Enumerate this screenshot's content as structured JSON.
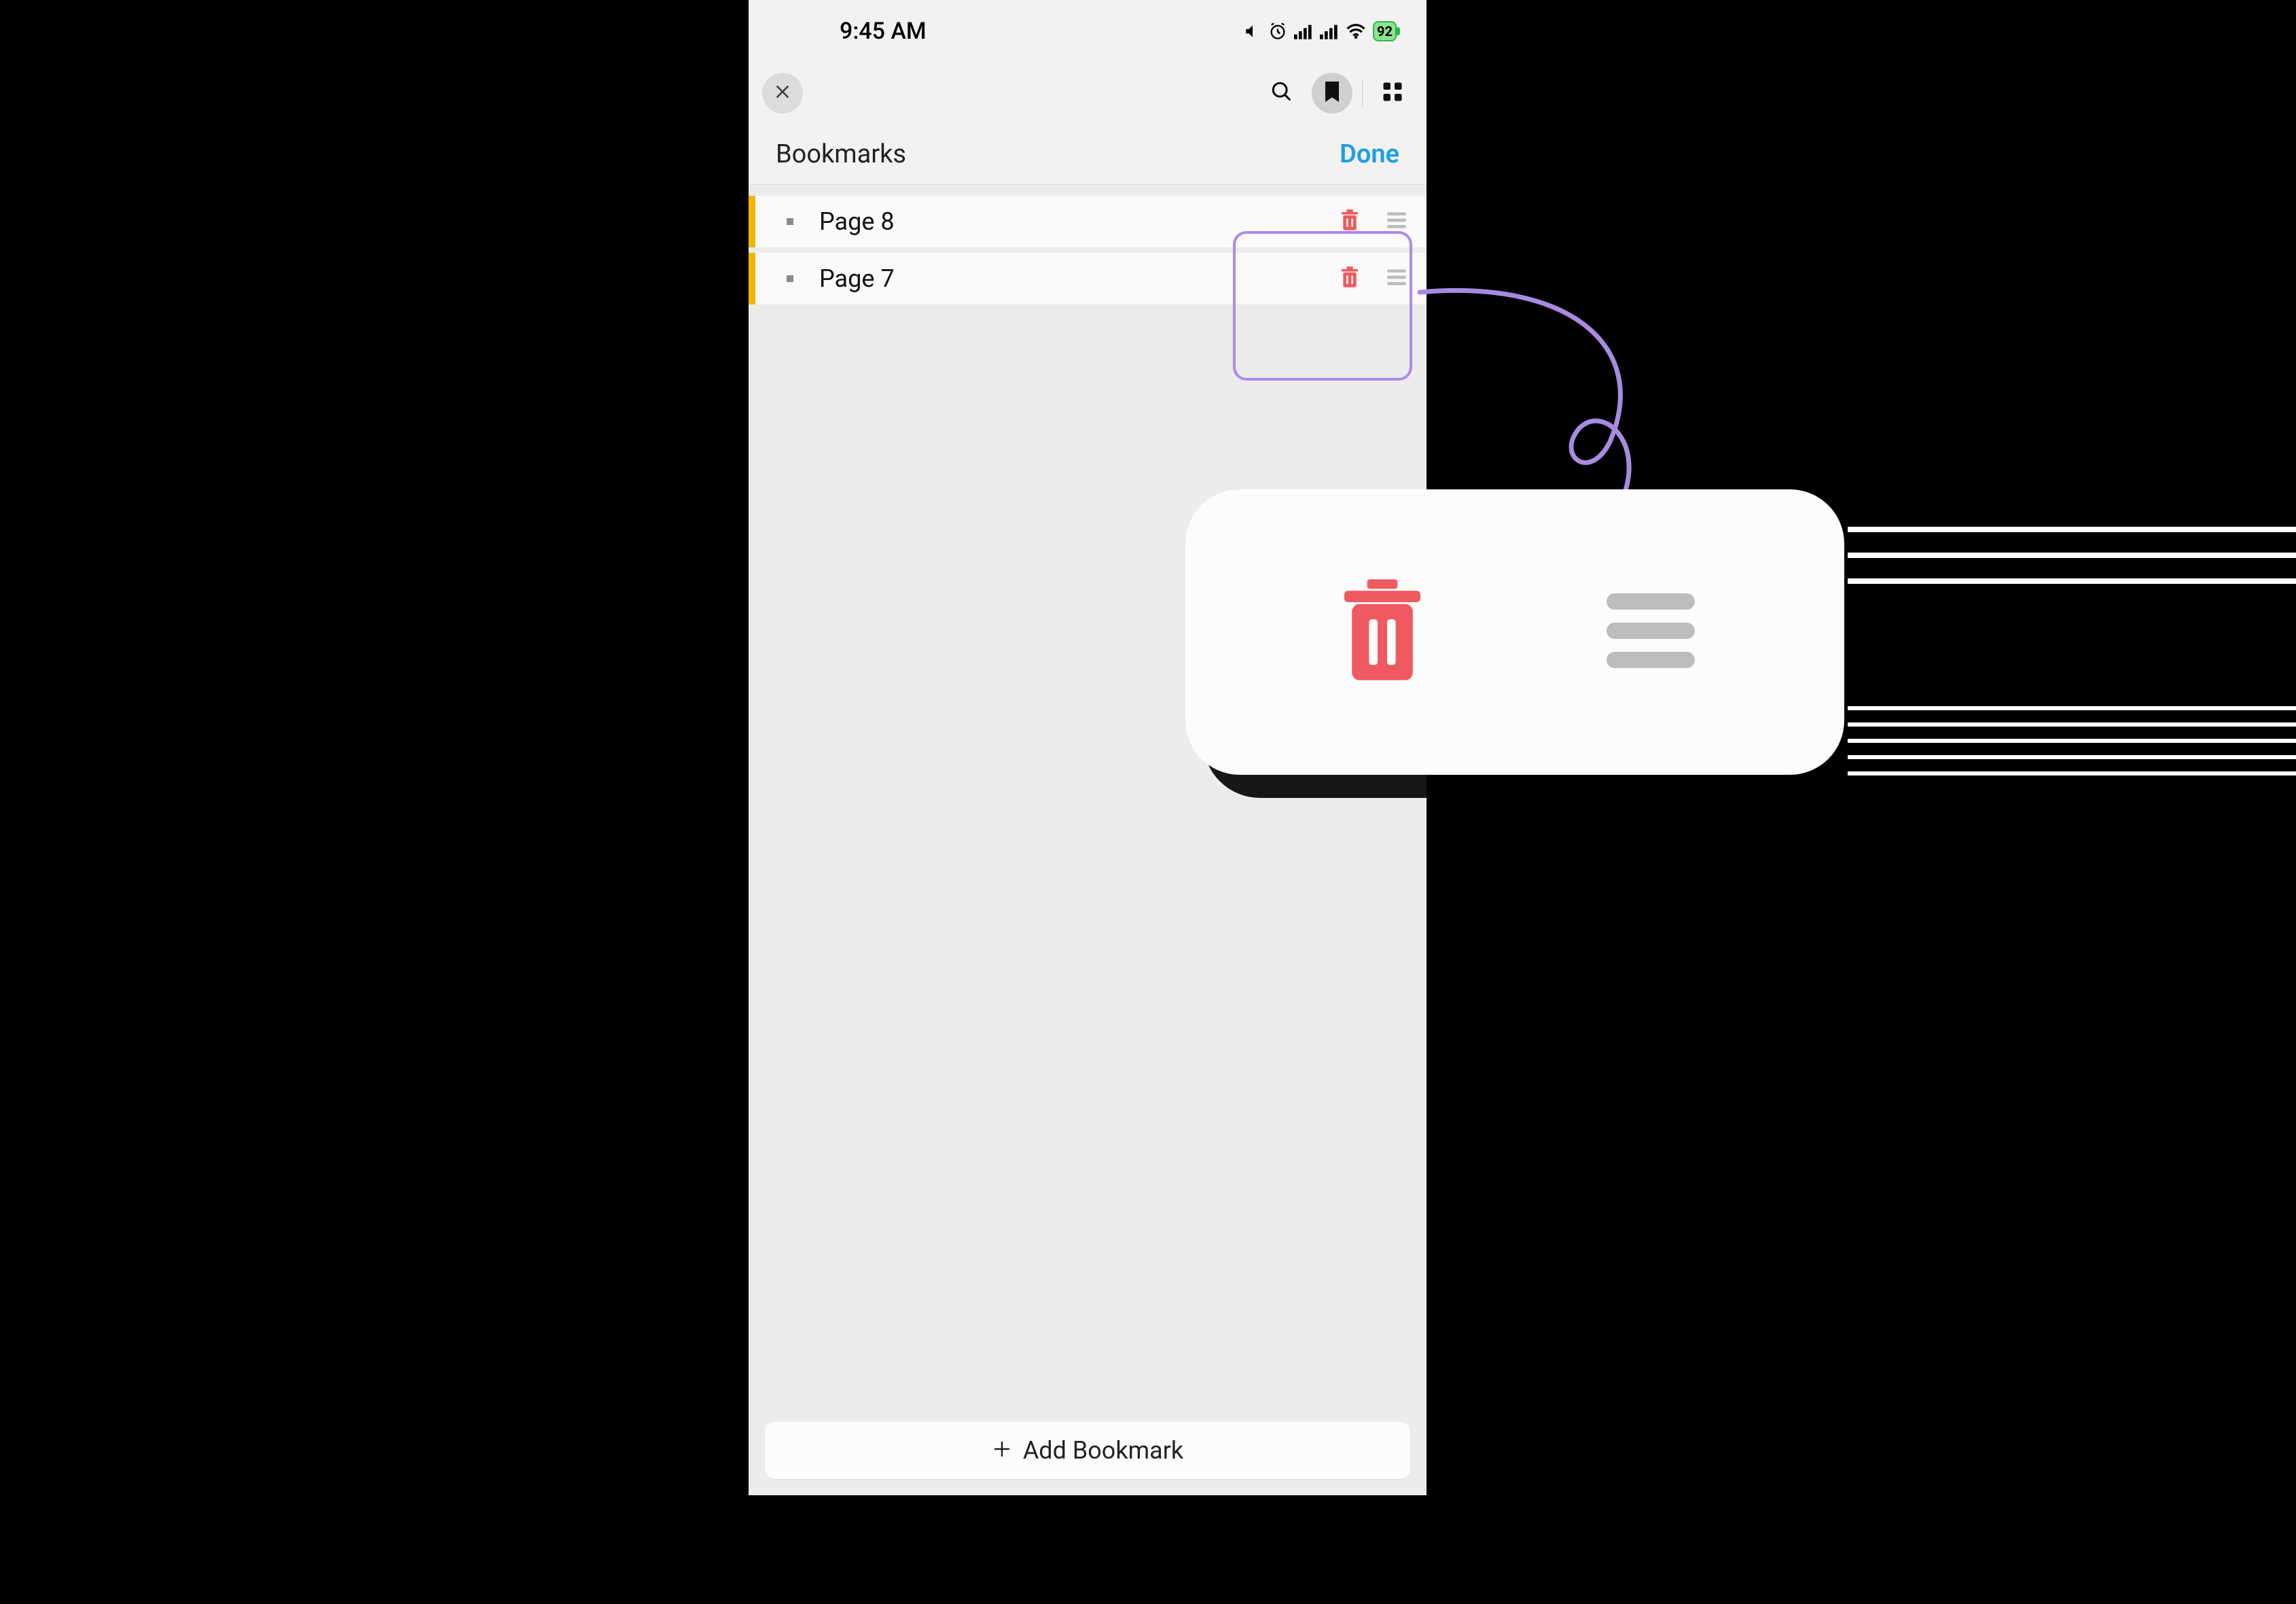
{
  "status": {
    "time": "9:45 AM",
    "battery": "92"
  },
  "section": {
    "title": "Bookmarks",
    "done_label": "Done"
  },
  "bookmarks": [
    {
      "label": "Page 8"
    },
    {
      "label": "Page 7"
    }
  ],
  "footer": {
    "add_label": "Add Bookmark"
  },
  "colors": {
    "accent": "#1e9ee6",
    "highlight": "#b088ec",
    "delete": "#ee5a5f",
    "bookmark_stripe": "#f5b400"
  }
}
